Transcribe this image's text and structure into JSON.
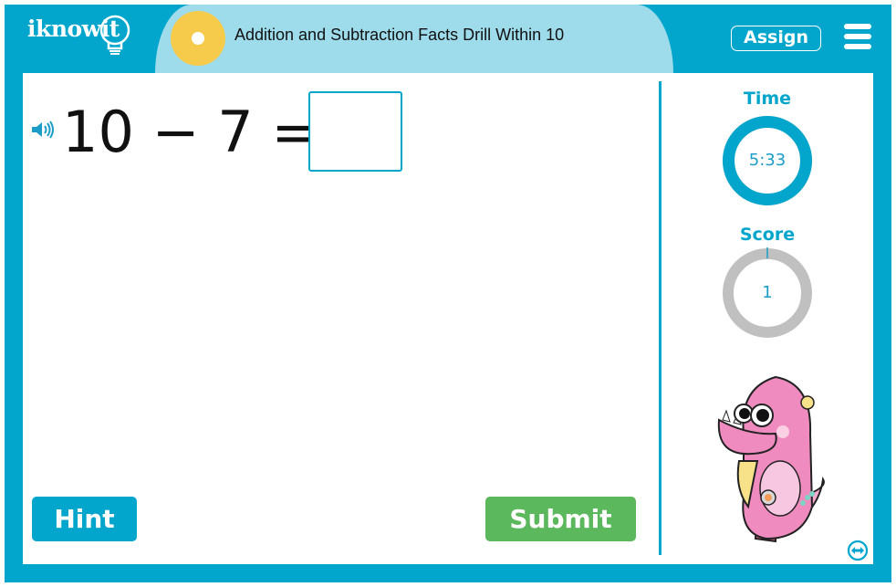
{
  "header": {
    "logo_text": "iknowit",
    "title": "Addition and Subtraction Facts Drill Within 10",
    "assign_label": "Assign",
    "menu_icon": "hamburger-menu-icon"
  },
  "question": {
    "speaker_icon": "speaker-icon",
    "equation": "10 − 7 =",
    "answer_value": "",
    "answer_placeholder": ""
  },
  "buttons": {
    "hint_label": "Hint",
    "submit_label": "Submit"
  },
  "stats": {
    "time_label": "Time",
    "time_value": "5:33",
    "time_progress_percent": 100,
    "score_label": "Score",
    "score_value": "1",
    "score_progress_percent": 0
  },
  "colors": {
    "brand_blue": "#02a6cd",
    "banner_light_blue": "#9edcec",
    "sun_yellow": "#f6cb4c",
    "submit_green": "#5cb85c",
    "ring_gray": "#c0c0c0"
  },
  "mascot": {
    "name": "pink-monster-mascot"
  },
  "footer": {
    "expand_icon": "expand-horizontal-icon"
  }
}
